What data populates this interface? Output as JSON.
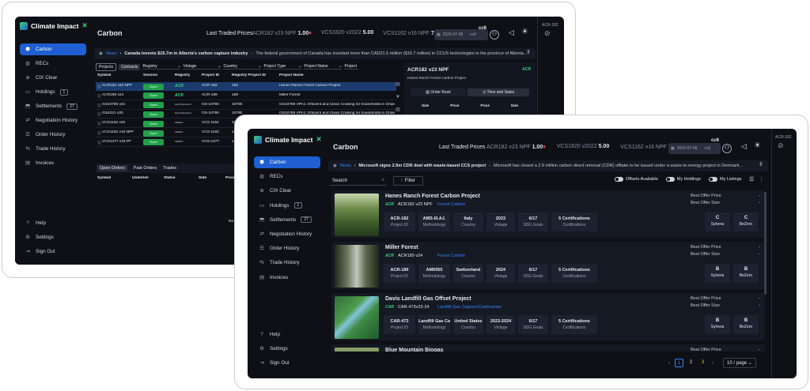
{
  "back": {
    "logo": "Climate Impact",
    "nav": [
      {
        "label": "Carbon"
      },
      {
        "label": "RECs"
      },
      {
        "label": "CIX Clear"
      },
      {
        "label": "Holdings",
        "badge": "1"
      },
      {
        "label": "Settlements",
        "badge": "27"
      },
      {
        "label": "Negotiation History"
      },
      {
        "label": "Order History"
      },
      {
        "label": "Trade History"
      },
      {
        "label": "Invoices"
      }
    ],
    "bottom_nav": [
      {
        "label": "Help"
      },
      {
        "label": "Settings"
      },
      {
        "label": "Sign Out"
      }
    ],
    "title": "Carbon",
    "last_traded_label": "Last Traded Prices",
    "prices": [
      {
        "sym": "ACR182 v23 NPF",
        "val": "1.00",
        "dir": "down"
      },
      {
        "sym": "VCS1820 v2022",
        "val": "5.00",
        "dir": ""
      },
      {
        "sym": "VCS1162 v16 NPF",
        "val": "7.00",
        "dir": "up"
      }
    ],
    "user": "cc6",
    "user_sub": "cc6",
    "date": "2025-07-08",
    "right_label": "ACR-182",
    "news_label": "News",
    "news_headline": "Canada invests $15.7m in Alberta's carbon capture industry",
    "news_text": "The federal government of Canada has invested more than CAD21.5 million ($15.7 million) in CCUS technologies in the province of Alberta...",
    "tabs": [
      "Projects",
      "Contracts"
    ],
    "filters": [
      "Registry",
      "Vintage",
      "Country",
      "Project Type",
      "Project Name",
      "Project"
    ],
    "columns": [
      "Symbol",
      "Session",
      "Registry",
      "Project ID",
      "Registry Project ID",
      "Project Name"
    ],
    "rows": [
      {
        "sym": "ACR182 v23 NPF",
        "session": "Open",
        "registry": "ACR",
        "pid": "ACR-182",
        "rpid": "182",
        "name": "Hanes Ranch Forest Carbon Project"
      },
      {
        "sym": "ACR189 v24",
        "session": "Open",
        "registry": "ACR",
        "pid": "ACR-189",
        "rpid": "189",
        "name": "Miller Forest"
      },
      {
        "sym": "GS10790 v21",
        "session": "Open",
        "registry": "Gold Standard",
        "pid": "GS-10790",
        "rpid": "10790",
        "name": "GS10789 VPA1: Efficient and Clean Cooking for households in Ghana"
      },
      {
        "sym": "GS4221 v20",
        "session": "Open",
        "registry": "Gold Standard",
        "pid": "GS-10790",
        "rpid": "10790",
        "name": "GS10789 VPA1: Efficient and Clean Cooking for households in Ghana"
      },
      {
        "sym": "VCS1152 v20",
        "session": "Open",
        "registry": "VERRA",
        "pid": "VCS-1152",
        "rpid": "1152",
        "name": "Arca Hydro Electricity Power Plant"
      },
      {
        "sym": "VCS1162 v16 NPF",
        "session": "Open",
        "registry": "VERRA",
        "pid": "VCS-1162",
        "rpid": "1162",
        "name": ""
      },
      {
        "sym": "VCS1477 v18 PF",
        "session": "Open",
        "registry": "VERRA",
        "pid": "VCS-1477",
        "rpid": "1477",
        "name": ""
      }
    ],
    "bottom_tabs": [
      "Open Orders",
      "Past Orders",
      "Trades"
    ],
    "order_cols": [
      "Symbol",
      "Underlier",
      "Status",
      "Side",
      "Price"
    ],
    "no_rows": "No Rows To S",
    "detail": {
      "symbol": "ACR182 v23 NPF",
      "name": "Hanes Ranch Forest Carbon Project",
      "registry": "ACR",
      "tab1": "Order Book",
      "tab2": "Time and Sales",
      "cols": [
        "Size",
        "Price",
        "Price",
        "Size"
      ]
    }
  },
  "front": {
    "logo": "Climate Impact",
    "nav": [
      {
        "label": "Carbon"
      },
      {
        "label": "RECs"
      },
      {
        "label": "CIX Clear"
      },
      {
        "label": "Holdings",
        "badge": "1"
      },
      {
        "label": "Settlements",
        "badge": "27"
      },
      {
        "label": "Negotiation History"
      },
      {
        "label": "Order History"
      },
      {
        "label": "Trade History"
      },
      {
        "label": "Invoices"
      }
    ],
    "bottom_nav": [
      {
        "label": "Help"
      },
      {
        "label": "Settings"
      },
      {
        "label": "Sign Out"
      }
    ],
    "title": "Carbon",
    "last_traded_label": "Last Traded Prices",
    "prices": [
      {
        "sym": "ACR182 v23 NPF",
        "val": "1.00",
        "dir": "down"
      },
      {
        "sym": "VCS1820 v2022",
        "val": "5.00",
        "dir": ""
      },
      {
        "sym": "VCS1162 v16 NPF",
        "val": "7.00",
        "dir": "up"
      }
    ],
    "user": "cc6",
    "user_sub": "cc6",
    "date": "2025-07-08",
    "news_label": "News",
    "news_headline": "Microsoft signs 2.9m CDR deal with waste-based CCS project",
    "news_text": "Microsoft has closed a 2.9 million carbon direct removal (CDR) offtake to be issued under a waste-to-energy project in Denmark...",
    "search_placeholder": "Search",
    "filter_label": "Filter",
    "toggles": [
      "Offsets Available",
      "My Holdings",
      "My Listings"
    ],
    "best_price_label": "Best Offer Price",
    "best_size_label": "Best Offer Size",
    "dash": "-",
    "projects": [
      {
        "title": "Hanes Ranch Forest Carbon Project",
        "registry": "ACR",
        "symbol": "ACR182 v23 NPF",
        "type": "Forest Carbon",
        "img": "forest1",
        "attrs": [
          {
            "v": "ACR-182",
            "l": "Project ID"
          },
          {
            "v": "AMS-III.AJ.",
            "l": "Methodology"
          },
          {
            "v": "Italy",
            "l": "Country"
          },
          {
            "v": "2023",
            "l": "Vintage"
          },
          {
            "v": "6/17",
            "l": "SDG Goals"
          },
          {
            "v": "5 Certifications",
            "l": "Certifications"
          }
        ],
        "ratings": [
          {
            "g": "C",
            "n": "Sylvera"
          },
          {
            "g": "C",
            "n": "BeZero"
          }
        ]
      },
      {
        "title": "Miller Forest",
        "registry": "ACR",
        "symbol": "ACR189 v24",
        "type": "Forest Carbon",
        "img": "forest2",
        "attrs": [
          {
            "v": "ACR-189",
            "l": "Project ID"
          },
          {
            "v": "AM0055",
            "l": "Methodology"
          },
          {
            "v": "Switzerland",
            "l": "Country"
          },
          {
            "v": "2024",
            "l": "Vintage"
          },
          {
            "v": "6/17",
            "l": "SDG Goals"
          },
          {
            "v": "5 Certifications",
            "l": "Certifications"
          }
        ],
        "ratings": [
          {
            "g": "B",
            "n": "Sylvera"
          },
          {
            "g": "B",
            "n": "BeZero"
          }
        ]
      },
      {
        "title": "Davis Landfill Gas Offset Project",
        "registry": "CAR",
        "symbol": "CAR-473v23-24",
        "type": "Landfill Gas Capture/Combustion",
        "img": "river",
        "attrs": [
          {
            "v": "CAR-473",
            "l": "Project ID"
          },
          {
            "v": "Landfill Gas Ca...",
            "l": "Methodology"
          },
          {
            "v": "United States",
            "l": "Country"
          },
          {
            "v": "2023-2024",
            "l": "Vintage"
          },
          {
            "v": "6/17",
            "l": "SDG Goals"
          },
          {
            "v": "5 Certifications",
            "l": "Certifications"
          }
        ],
        "ratings": [
          {
            "g": "B",
            "n": "Sylvera"
          },
          {
            "g": "B",
            "n": "BeZero"
          }
        ]
      },
      {
        "title": "Blue Mountain Biogas",
        "registry": "",
        "symbol": "",
        "type": "",
        "img": "field",
        "attrs": [],
        "ratings": []
      }
    ],
    "pages": [
      "1",
      "2",
      "3"
    ],
    "page_size": "10 / page",
    "right_label": "ACR-182"
  },
  "colors": {
    "accent": "#1f5fd1",
    "green": "#22a04a",
    "bg": "#0e1016",
    "panel": "#151923",
    "link": "#3b82f6"
  }
}
